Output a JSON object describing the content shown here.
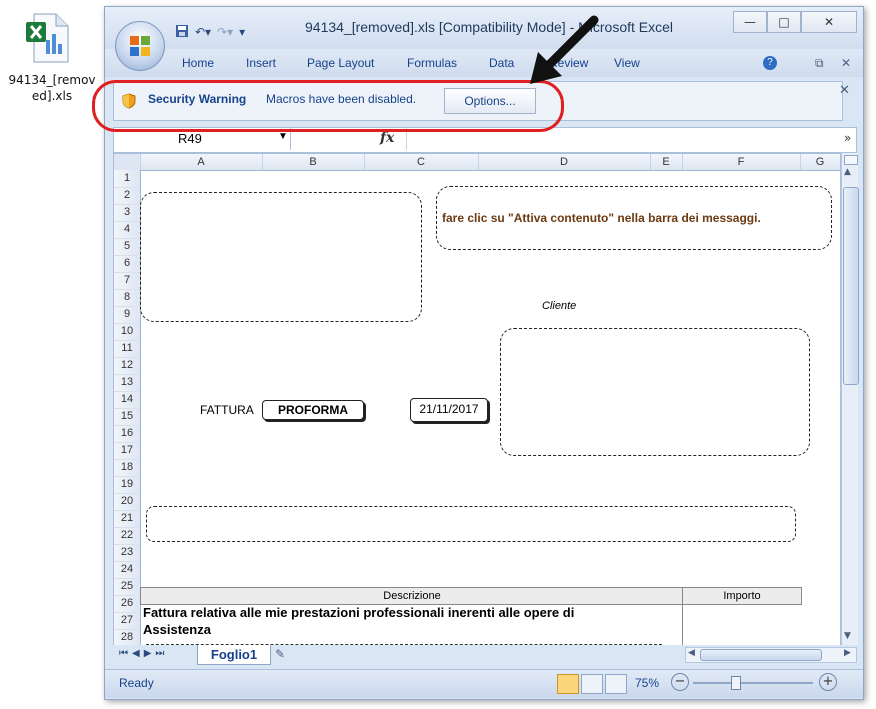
{
  "desktop": {
    "file_label": "94134_[removed].xls"
  },
  "window": {
    "title": "94134_[removed].xls  [Compatibility Mode] - Microsoft Excel",
    "controls": {
      "minimize": "—",
      "maximize": "□",
      "close": "✕"
    }
  },
  "ribbon": {
    "tabs": [
      "Home",
      "Insert",
      "Page Layout",
      "Formulas",
      "Data",
      "Review",
      "View"
    ],
    "help": "?",
    "restore": "⧉",
    "close": "✕"
  },
  "message_bar": {
    "title": "Security Warning",
    "message": "Macros have been disabled.",
    "options_label": "Options...",
    "close": "✕"
  },
  "formula_bar": {
    "name_box": "R49",
    "fx": "fx",
    "formula": "",
    "expand": "»"
  },
  "sheet": {
    "columns": [
      "A",
      "B",
      "C",
      "D",
      "E",
      "F",
      "G"
    ],
    "rows": [
      "1",
      "2",
      "3",
      "4",
      "5",
      "6",
      "7",
      "8",
      "9",
      "10",
      "11",
      "12",
      "13",
      "14",
      "15",
      "16",
      "17",
      "18",
      "19",
      "20",
      "21",
      "22",
      "23",
      "24",
      "25",
      "26",
      "27",
      "28"
    ],
    "macro_notice": "fare clic su \"Attiva contenuto\" nella barra dei messaggi.",
    "cliente_label": "Cliente",
    "fattura_label": "FATTURA",
    "proforma_label": "PROFORMA",
    "date_value": "21/11/2017",
    "table_header_desc": "Descrizione",
    "table_header_amount": "Importo",
    "line1": "Fattura relativa alle mie prestazioni professionali inerenti alle opere di",
    "line2": "Assistenza"
  },
  "sheet_tabs": {
    "active": "Foglio1"
  },
  "status": {
    "ready": "Ready",
    "zoom": "75%",
    "zoom_minus": "−",
    "zoom_plus": "+"
  }
}
